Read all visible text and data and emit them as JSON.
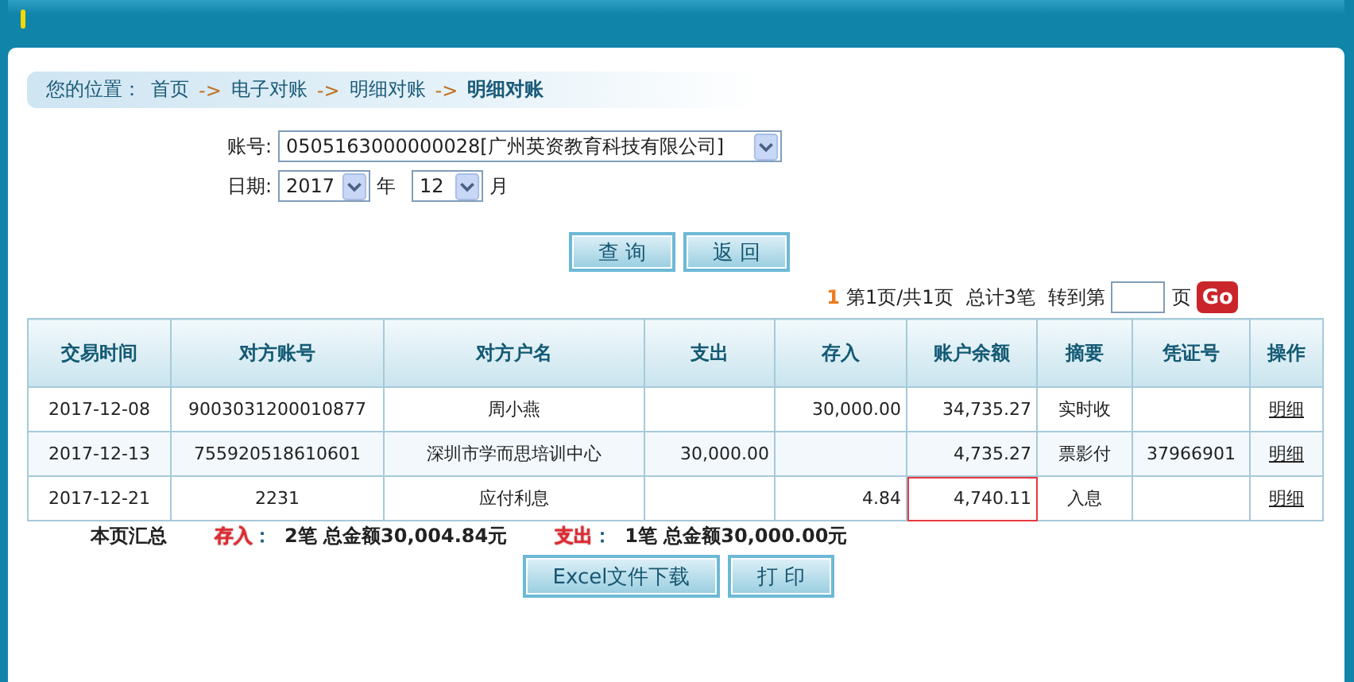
{
  "breadcrumb": {
    "prefix": "您的位置：",
    "items": [
      "首页",
      "电子对账",
      "明细对账"
    ],
    "separator": "->",
    "current": "明细对账"
  },
  "form": {
    "account": {
      "label": "账号:",
      "value": "0505163000000028[广州英资教育科技有限公司]"
    },
    "date": {
      "label": "日期:",
      "year": "2017",
      "year_unit": "年",
      "month": "12",
      "month_unit": "月"
    }
  },
  "buttons": [
    "查 询",
    "返 回"
  ],
  "pagination": {
    "current": "1",
    "info": "第1页/共1页",
    "total": "总计3笔",
    "goto_label": "转到第",
    "goto_unit": "页",
    "go": "Go"
  },
  "table": {
    "columns": [
      "交易时间",
      "对方账号",
      "对方户名",
      "支出",
      "存入",
      "账户余额",
      "摘要",
      "凭证号",
      "操作"
    ],
    "rows": [
      {
        "time": "2017-12-08",
        "account": "9003031200010877",
        "name": "周小燕",
        "out": "",
        "in": "30,000.00",
        "balance": "34,735.27",
        "summary": "实时收",
        "voucher": "",
        "action": "明细",
        "highlighted": false
      },
      {
        "time": "2017-12-13",
        "account": "755920518610601",
        "name": "深圳市学而思培训中心",
        "out": "30,000.00",
        "in": "",
        "balance": "4,735.27",
        "summary": "票影付",
        "voucher": "37966901",
        "action": "明细",
        "highlighted": false
      },
      {
        "time": "2017-12-21",
        "account": "2231",
        "name": "应付利息",
        "out": "",
        "in": "4.84",
        "balance": "4,740.11",
        "summary": "入息",
        "voucher": "",
        "action": "明细",
        "highlighted": true
      }
    ]
  },
  "summary": {
    "title": "本页汇总",
    "groups": [
      {
        "label": "存入",
        "colon": "：",
        "text": "2笔  总金额30,004.84元"
      },
      {
        "label": "支出",
        "colon": "：",
        "text": "1笔  总金额30,000.00元"
      }
    ]
  },
  "bottom_buttons": [
    "Excel文件下载",
    "打 印"
  ]
}
